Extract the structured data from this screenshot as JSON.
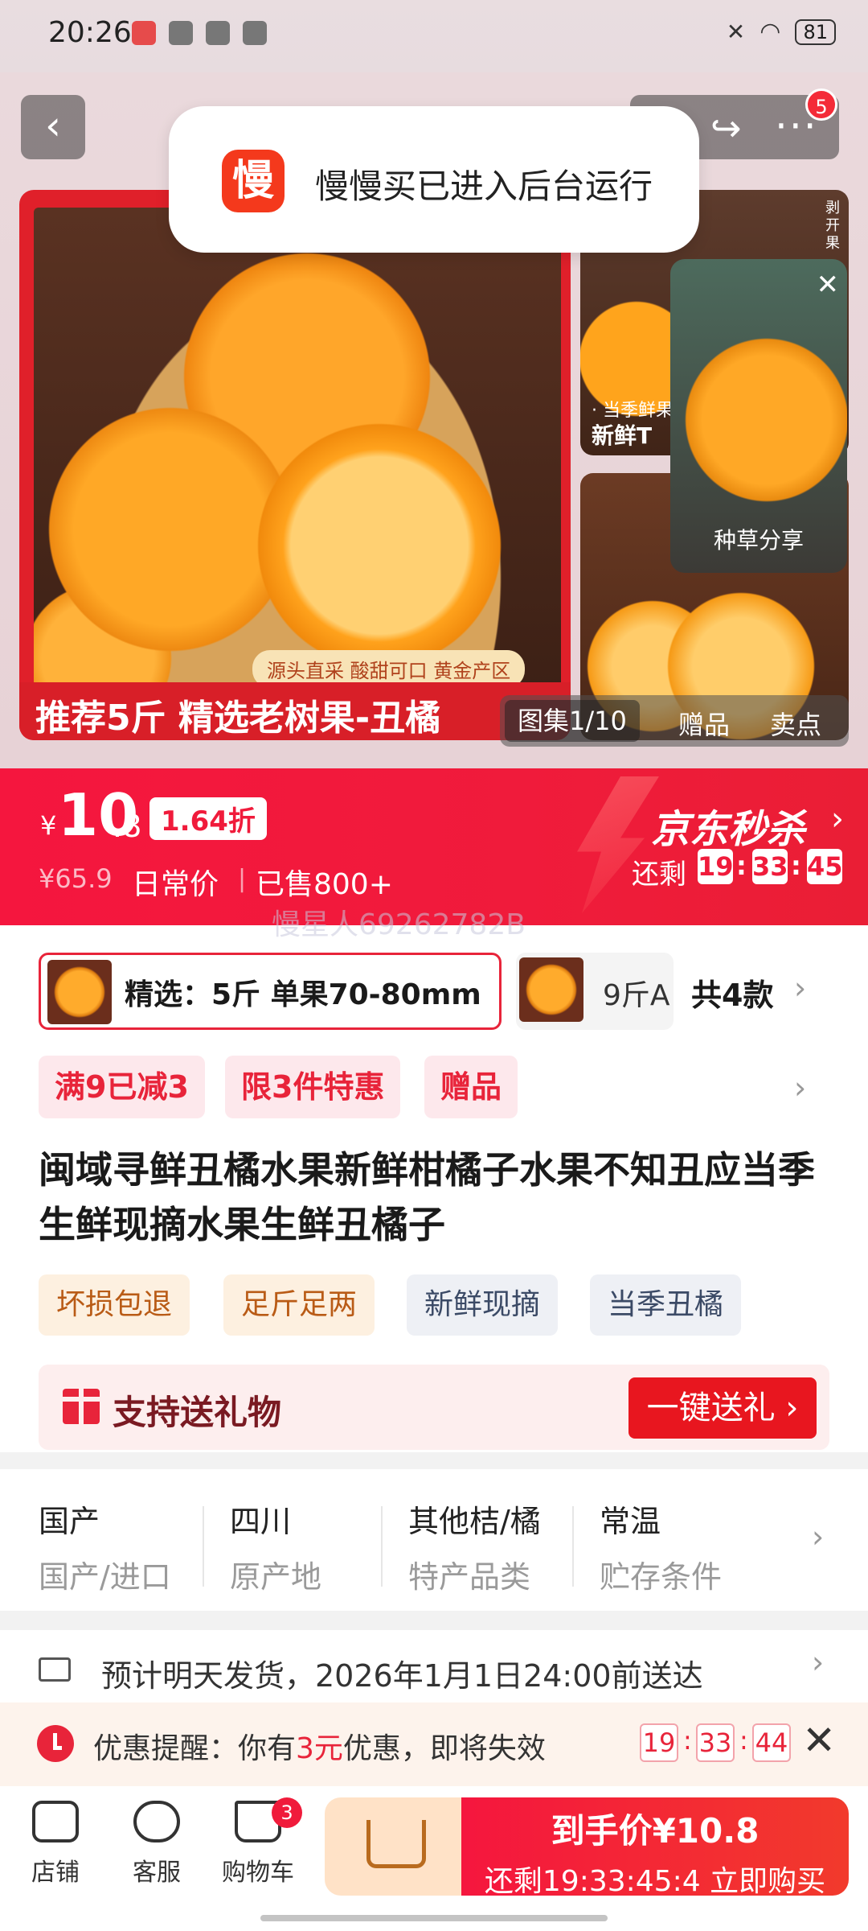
{
  "status_bar": {
    "time": "20:26",
    "battery": "81"
  },
  "header": {
    "back_icon": "chevron-left-icon",
    "share_icon": "share-icon",
    "more_icon": "more-icon",
    "more_badge": "5"
  },
  "toast": {
    "app_icon_char": "慢",
    "text": "慢慢买已进入后台运行"
  },
  "gallery": {
    "main_caption": "源头直采 酸甜可口 黄金产区",
    "main_banner": "推荐5斤  精选老树果-丑橘",
    "side1_line1": "· 当季鲜果",
    "side1_line2": "新鲜T",
    "side_label": "剥开果",
    "mini_video_label": "种草分享",
    "tabs": [
      "图集1/10",
      "赠品",
      "卖点"
    ]
  },
  "price": {
    "currency": "¥",
    "integer": "10",
    "decimal": ".8",
    "discount": "1.64折",
    "original": "¥65.9",
    "original_label": "日常价",
    "separator": "|",
    "sold": "已售800+",
    "seckill": "京东秒杀",
    "remain_label": "还剩",
    "countdown": [
      "19",
      "33",
      "45"
    ]
  },
  "watermark": "慢星人69262782B",
  "sku": {
    "selected_label": "精选：5斤 单果70-80mm",
    "other_label": "9斤A",
    "count": "共4款"
  },
  "promos": [
    "满9已减3",
    "限3件特惠",
    "赠品"
  ],
  "title": "闽域寻鲜丑橘水果新鲜柑橘子水果不知丑应当季生鲜现摘水果生鲜丑橘子",
  "tags": [
    "坏损包退",
    "足斤足两",
    "新鲜现摘",
    "当季丑橘"
  ],
  "gift": {
    "text": "支持送礼物",
    "button": "一键送礼 ›"
  },
  "attributes": [
    {
      "value": "国产",
      "key": "国产/进口"
    },
    {
      "value": "四川",
      "key": "原产地"
    },
    {
      "value": "其他桔/橘",
      "key": "特产品类"
    },
    {
      "value": "常温",
      "key": "贮存条件"
    }
  ],
  "shipping": "预计明天发货，2026年1月1日24:00前送达",
  "reminder": {
    "prefix": "优惠提醒：你有",
    "amount": "3元",
    "suffix": "优惠，即将失效",
    "countdown": [
      "19",
      "33",
      "44"
    ]
  },
  "bottom": {
    "store": "店铺",
    "service": "客服",
    "cart": "购物车",
    "cart_badge": "3",
    "buy_line1": "到手价¥10.8",
    "buy_line2": "还剩19:33:45:4 立即购买"
  },
  "colors": {
    "accent": "#f01b3b",
    "gift_bg": "#fdeeee",
    "tag_warm": "#fdf0e0"
  }
}
